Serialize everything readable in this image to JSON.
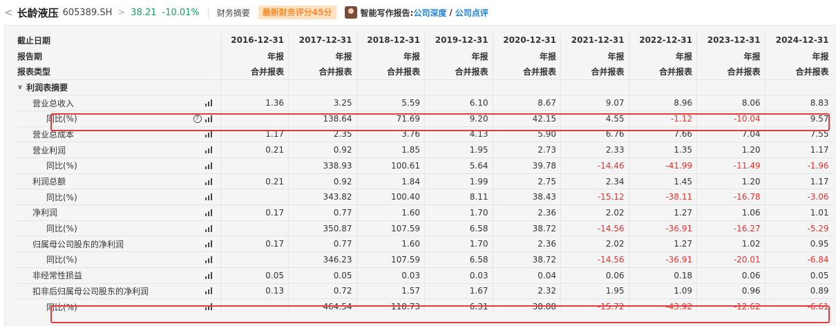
{
  "header": {
    "back_glyph": "<",
    "stock_name": "长龄液压",
    "stock_code": "605389.SH",
    "chev": ">",
    "price": "38.21",
    "change_pct": "-10.01%",
    "fin_summary": "财务摘要",
    "score_badge": "最新财务评分45分",
    "ai_label": "智能写作报告:",
    "ai_link1": "公司深度",
    "ai_slash": "/",
    "ai_link2": "公司点评"
  },
  "table": {
    "header_rows": [
      {
        "label": "截止日期",
        "values": [
          "2016-12-31",
          "2017-12-31",
          "2018-12-31",
          "2019-12-31",
          "2020-12-31",
          "2021-12-31",
          "2022-12-31",
          "2023-12-31",
          "2024-12-31"
        ]
      },
      {
        "label": "报告期",
        "values": [
          "年报",
          "年报",
          "年报",
          "年报",
          "年报",
          "年报",
          "年报",
          "年报",
          "年报"
        ]
      },
      {
        "label": "报表类型",
        "values": [
          "合并报表",
          "合并报表",
          "合并报表",
          "合并报表",
          "合并报表",
          "合并报表",
          "合并报表",
          "合并报表",
          "合并报表"
        ]
      }
    ],
    "section_label": "利润表摘要",
    "rows": [
      {
        "label": "营业总收入",
        "indent": 1,
        "help": false,
        "values": [
          "1.36",
          "3.25",
          "5.59",
          "6.10",
          "8.67",
          "9.07",
          "8.96",
          "8.06",
          "8.83"
        ]
      },
      {
        "label": "同比(%)",
        "indent": 2,
        "help": true,
        "highlight": true,
        "values": [
          "",
          "138.64",
          "71.69",
          "9.20",
          "42.15",
          "4.55",
          "-1.12",
          "-10.04",
          "9.57"
        ]
      },
      {
        "label": "营业总成本",
        "indent": 1,
        "help": false,
        "values": [
          "1.17",
          "2.35",
          "3.76",
          "4.13",
          "5.90",
          "6.76",
          "7.66",
          "7.04",
          "7.55"
        ]
      },
      {
        "label": "营业利润",
        "indent": 1,
        "help": false,
        "values": [
          "0.21",
          "0.92",
          "1.85",
          "1.95",
          "2.73",
          "2.33",
          "1.35",
          "1.20",
          "1.17"
        ]
      },
      {
        "label": "同比(%)",
        "indent": 2,
        "help": false,
        "values": [
          "",
          "338.93",
          "100.61",
          "5.64",
          "39.78",
          "-14.46",
          "-41.99",
          "-11.49",
          "-1.96"
        ]
      },
      {
        "label": "利润总额",
        "indent": 1,
        "help": false,
        "values": [
          "0.21",
          "0.92",
          "1.84",
          "1.99",
          "2.75",
          "2.34",
          "1.45",
          "1.20",
          "1.17"
        ]
      },
      {
        "label": "同比(%)",
        "indent": 2,
        "help": false,
        "values": [
          "",
          "343.82",
          "100.40",
          "8.11",
          "38.43",
          "-15.12",
          "-38.11",
          "-16.78",
          "-3.06"
        ]
      },
      {
        "label": "净利润",
        "indent": 1,
        "help": false,
        "values": [
          "0.17",
          "0.77",
          "1.60",
          "1.70",
          "2.36",
          "2.02",
          "1.27",
          "1.06",
          "1.01"
        ]
      },
      {
        "label": "同比(%)",
        "indent": 2,
        "help": false,
        "values": [
          "",
          "350.87",
          "107.59",
          "6.58",
          "38.72",
          "-14.56",
          "-36.91",
          "-16.27",
          "-5.29"
        ]
      },
      {
        "label": "归属母公司股东的净利润",
        "indent": 1,
        "help": false,
        "values": [
          "0.17",
          "0.77",
          "1.60",
          "1.70",
          "2.36",
          "2.02",
          "1.27",
          "1.02",
          "0.95"
        ]
      },
      {
        "label": "同比(%)",
        "indent": 2,
        "help": false,
        "values": [
          "",
          "346.23",
          "107.59",
          "6.58",
          "38.72",
          "-14.56",
          "-36.91",
          "-20.01",
          "-6.84"
        ]
      },
      {
        "label": "非经常性损益",
        "indent": 1,
        "help": false,
        "values": [
          "0.05",
          "0.05",
          "0.03",
          "0.03",
          "0.04",
          "0.06",
          "0.18",
          "0.06",
          "0.05"
        ]
      },
      {
        "label": "扣非后归属母公司股东的净利润",
        "indent": 1,
        "help": false,
        "values": [
          "0.13",
          "0.72",
          "1.57",
          "1.67",
          "2.32",
          "1.95",
          "1.09",
          "0.96",
          "0.89"
        ]
      },
      {
        "label": "同比(%)",
        "indent": 2,
        "help": false,
        "highlight": true,
        "values": [
          "",
          "464.54",
          "118.73",
          "6.31",
          "38.88",
          "-15.72",
          "-43.92",
          "-12.62",
          "-6.61"
        ]
      }
    ]
  },
  "colors": {
    "up": "#13a05a",
    "negative": "#e8302b",
    "link": "#1e7fd9",
    "highlight": "#e33b3b",
    "score_text": "#ff8a2a"
  }
}
